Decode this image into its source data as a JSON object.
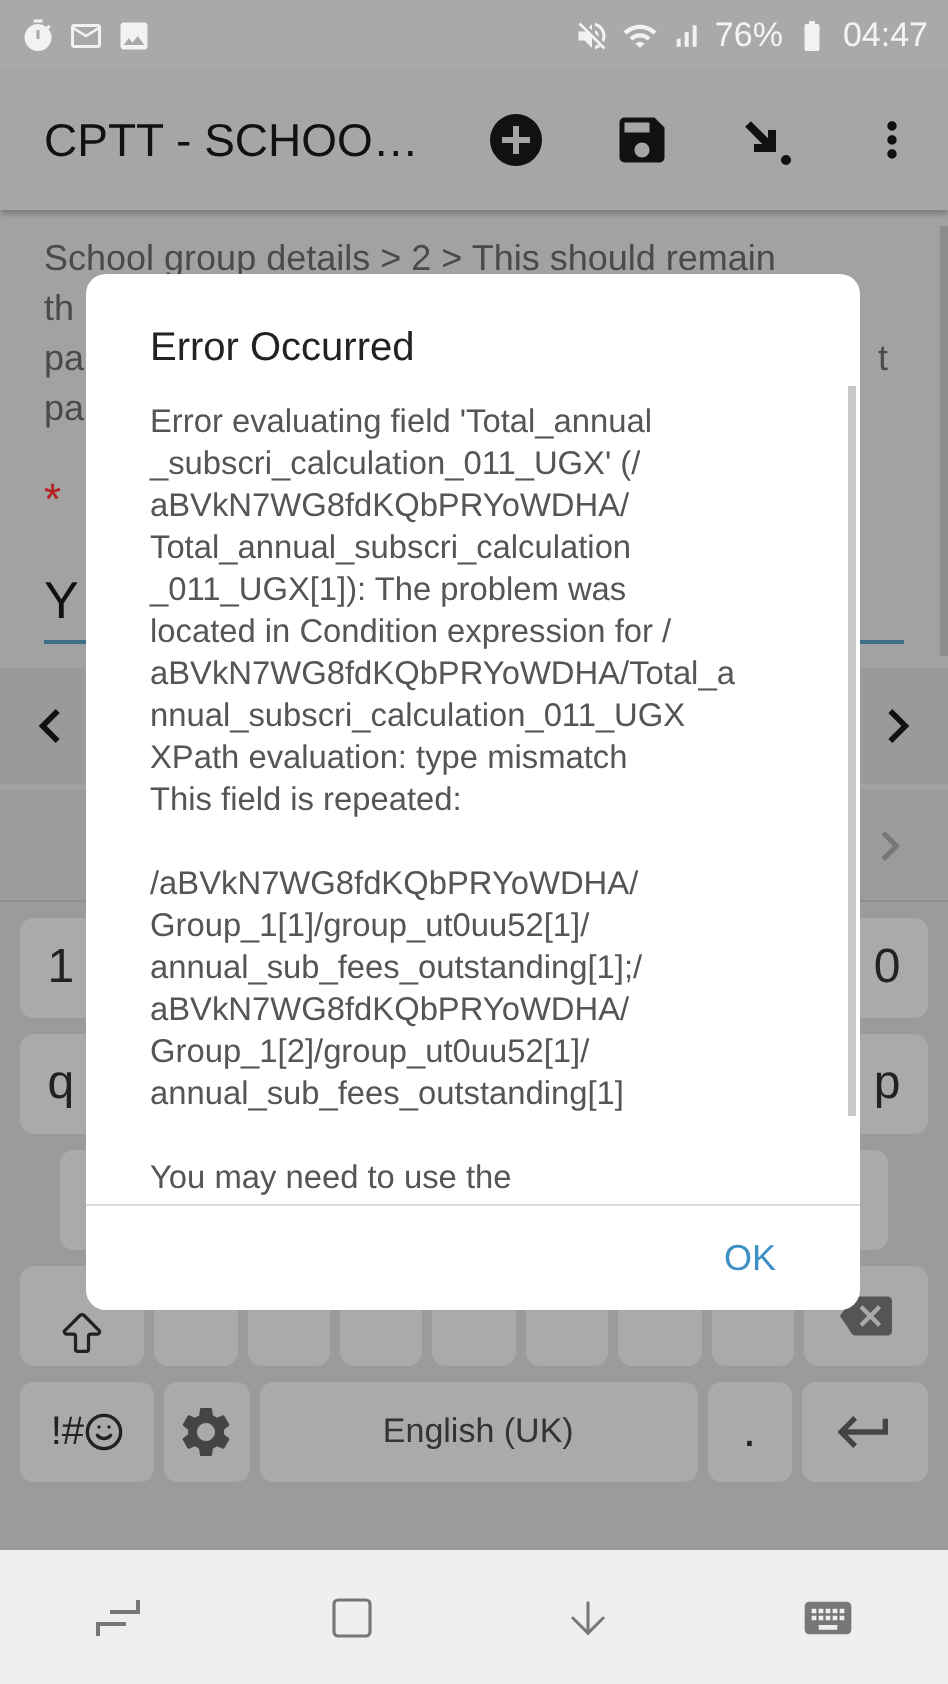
{
  "status_bar": {
    "battery": "76%",
    "time": "04:47"
  },
  "app_bar": {
    "title": "CPTT - SCHOO…"
  },
  "form": {
    "breadcrumb": "School group details > 2 > This should remain",
    "left_fragments": [
      "th",
      "pa",
      "pa"
    ],
    "right_fragment": "t",
    "required_mark": "*",
    "answer_fragment": "Y"
  },
  "keyboard": {
    "number_row": [
      "1",
      "0"
    ],
    "letter_row": [
      "q",
      "p"
    ],
    "symbols": "!#",
    "space": "English (UK)",
    "period": "."
  },
  "dialog": {
    "title": "Error Occurred",
    "paragraphs": [
      "Error evaluating field 'Total_annual\n_subscri_calculation_011_UGX' (/\naBVkN7WG8fdKQbPRYoWDHA/\nTotal_annual_subscri_calculation\n_011_UGX[1]): The problem was\nlocated in Condition expression for /\naBVkN7WG8fdKQbPRYoWDHA/Total_a\nnnual_subscri_calculation_011_UGX\nXPath evaluation: type mismatch\nThis field is repeated:",
      "/aBVkN7WG8fdKQbPRYoWDHA/\nGroup_1[1]/group_ut0uu52[1]/\nannual_sub_fees_outstanding[1];/\naBVkN7WG8fdKQbPRYoWDHA/\nGroup_1[2]/group_ut0uu52[1]/\nannual_sub_fees_outstanding[1]",
      "You may need to use the"
    ],
    "button": "OK"
  }
}
